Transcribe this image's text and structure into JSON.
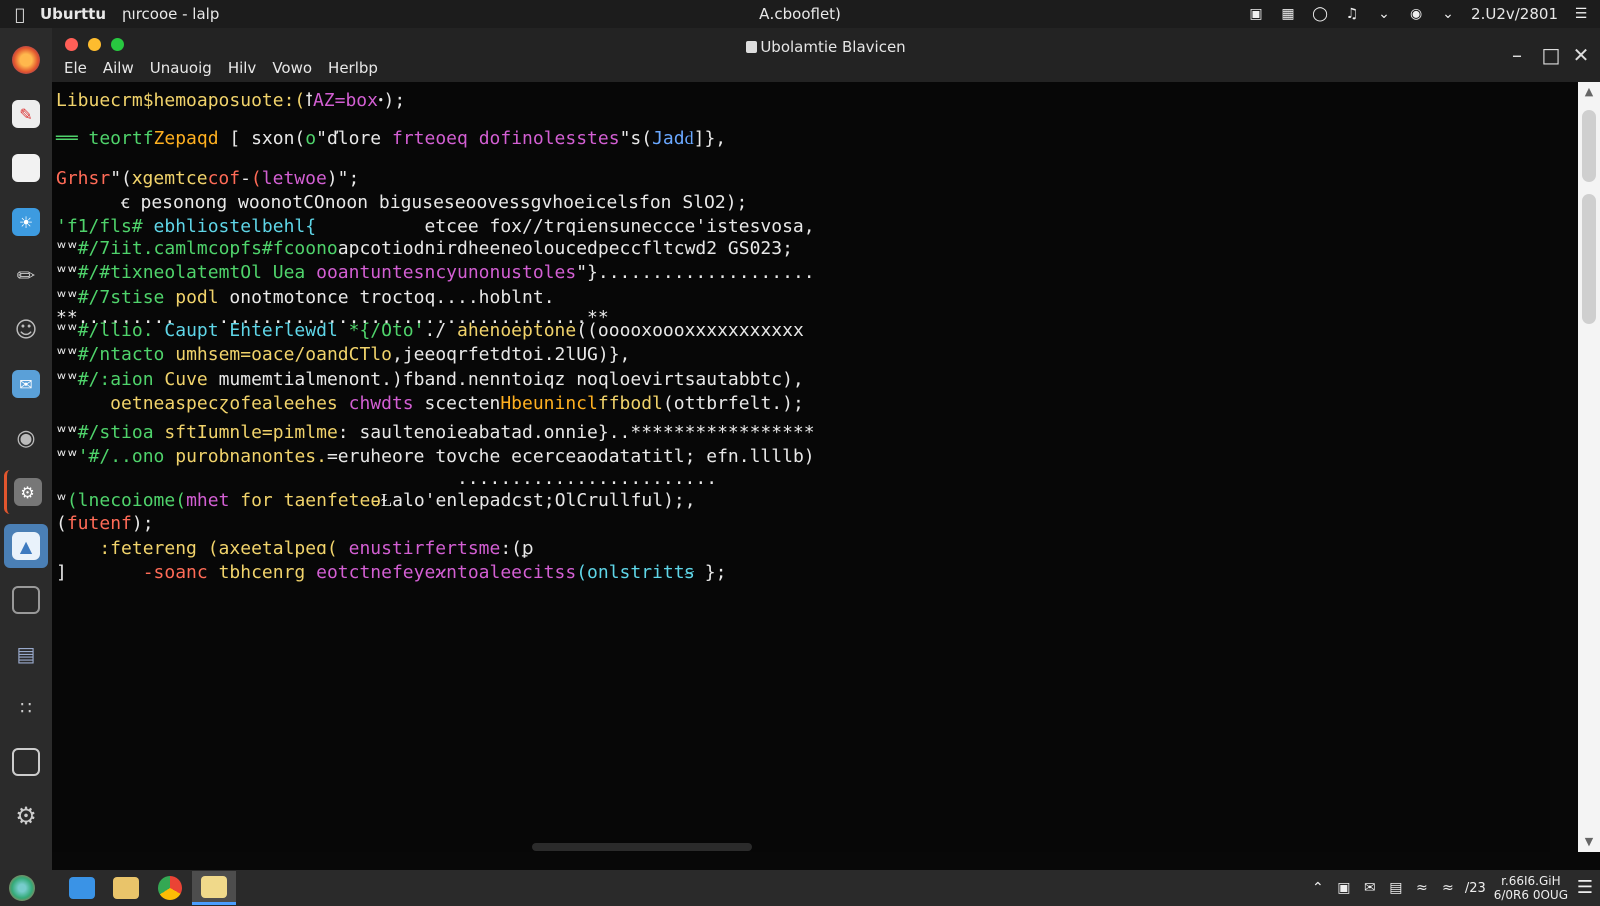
{
  "topbar": {
    "app_name": "Uburttu",
    "app_menu": "ꞃırcooe - lalp",
    "center_title": "A․cbooflet)",
    "clock": "2.U2v/2801"
  },
  "window": {
    "title": "Ubolamtie Blavicen",
    "menu": [
      "Ele",
      "Ailw",
      "Unauoig",
      "Hilv",
      "Vowo",
      "Herlbp"
    ]
  },
  "terminal_lines": [
    [
      {
        "t": "Libuecrm$hemoaposuote:(",
        "c": "c-y"
      },
      {
        "t": "ꝉ",
        "c": "c-w"
      },
      {
        "t": "AZ=box",
        "c": "c-p"
      },
      {
        "t": "ꞏ);",
        "c": "c-w"
      }
    ],
    [
      {
        "t": "══ teortf",
        "c": "c-g"
      },
      {
        "t": "Zepaqd",
        "c": "c-o"
      },
      {
        "t": " [ sxon(",
        "c": "c-w"
      },
      {
        "t": "o",
        "c": "c-g"
      },
      {
        "t": "\"ďlore ",
        "c": "c-w"
      },
      {
        "t": "frteoeq ",
        "c": "c-p"
      },
      {
        "t": "dofinolesstes",
        "c": "c-p"
      },
      {
        "t": "\"s(",
        "c": "c-w"
      },
      {
        "t": "Jadԁ",
        "c": "c-b"
      },
      {
        "t": "]},",
        "c": "c-w"
      }
    ],
    [
      {
        "t": "Grhsr",
        "c": "c-r"
      },
      {
        "t": "\"(",
        "c": "c-w"
      },
      {
        "t": "ⅹgemtce",
        "c": "c-y"
      },
      {
        "t": "cof",
        "c": "c-r"
      },
      {
        "t": "-",
        "c": "c-w"
      },
      {
        "t": "(",
        "c": "c-r"
      },
      {
        "t": "letwoe",
        "c": "c-p"
      },
      {
        "t": ")\";",
        "c": "c-w"
      }
    ],
    [
      {
        "t": "      ꞓ pesonong woonotCOnoon biguseseoovessgvhoeicelsfon SlO2);",
        "c": "c-w"
      }
    ],
    [
      {
        "t": "'f1/fls#",
        "c": "c-g"
      },
      {
        "t": " ebhliostelbehl{          ",
        "c": "c-c"
      },
      {
        "t": "etcee fox//trqiensuneccce'istesvosa,",
        "c": "c-w"
      }
    ],
    [
      {
        "t": "ʷʷ",
        "c": "c-w"
      },
      {
        "t": "#/7iit.camlmcopfs#fcoono",
        "c": "c-g"
      },
      {
        "t": "apcotiodnirdheeneoloucedpeccfltcwd2 GS023;",
        "c": "c-w"
      }
    ],
    [
      {
        "t": "ʷʷ",
        "c": "c-w"
      },
      {
        "t": "#/#tixneolatemtOl Uea ",
        "c": "c-g"
      },
      {
        "t": "ooantuntesncyunonustoles",
        "c": "c-p"
      },
      {
        "t": "\"}....................",
        "c": "c-w"
      }
    ],
    [
      {
        "t": "ʷʷ",
        "c": "c-w"
      },
      {
        "t": "#/7stise",
        "c": "c-g"
      },
      {
        "t": " podl ",
        "c": "c-y"
      },
      {
        "t": "onotmotonce troctoq....hoblnt.",
        "c": "c-w"
      }
    ],
    [
      {
        "t": "**.........    ..................................**",
        "c": "c-w"
      }
    ],
    [
      {
        "t": "ʷʷ",
        "c": "c-w"
      },
      {
        "t": "#/llio. ",
        "c": "c-g"
      },
      {
        "t": "Caupt Ehterlewdl ",
        "c": "c-c"
      },
      {
        "t": "*{/Oto'",
        "c": "c-g"
      },
      {
        "t": "./ ",
        "c": "c-w"
      },
      {
        "t": "ahenoeptone",
        "c": "c-y"
      },
      {
        "t": "((ooooxoooxxxxxxxxxxx",
        "c": "c-w"
      }
    ],
    [
      {
        "t": "ʷʷ",
        "c": "c-w"
      },
      {
        "t": "#/ntacto ",
        "c": "c-g"
      },
      {
        "t": "umhsem=oace/oandCTlo",
        "c": "c-y"
      },
      {
        "t": ",jeeoqrfetdtoi.2lUG)},",
        "c": "c-w"
      }
    ],
    [
      {
        "t": "ʷʷ",
        "c": "c-w"
      },
      {
        "t": "#/:aion ",
        "c": "c-g"
      },
      {
        "t": "Cuve ",
        "c": "c-y"
      },
      {
        "t": "mumemtialmenont.)fband.nenntoiqz noqloevirtsautabbtc),",
        "c": "c-w"
      }
    ],
    [
      {
        "t": "     oetneaspecɀofealeehes ",
        "c": "c-y"
      },
      {
        "t": "chwdts ",
        "c": "c-p"
      },
      {
        "t": "scecten",
        "c": "c-w"
      },
      {
        "t": "Hbeunincl",
        "c": "c-o"
      },
      {
        "t": "ffbodl",
        "c": "c-y"
      },
      {
        "t": "(ottbrfelt.);",
        "c": "c-w"
      }
    ],
    [
      {
        "t": "ʷʷ",
        "c": "c-w"
      },
      {
        "t": "#/stioa ",
        "c": "c-g"
      },
      {
        "t": "sftIumnle=pimlme",
        "c": "c-y"
      },
      {
        "t": ": saultenoieabatad.onnie}..*****************",
        "c": "c-w"
      }
    ],
    [
      {
        "t": "ʷʷ",
        "c": "c-w"
      },
      {
        "t": "'#/..ono ",
        "c": "c-g"
      },
      {
        "t": "purobnanontes.",
        "c": "c-y"
      },
      {
        "t": "=eruheore tovche ecerceaodatatitl; efn.llllb)",
        "c": "c-w"
      }
    ],
    [
      {
        "t": "                                     ........................",
        "c": "c-w"
      }
    ],
    [
      {
        "t": "ʷ",
        "c": "c-w"
      },
      {
        "t": "(lnecoiome(",
        "c": "c-g"
      },
      {
        "t": "mhet",
        "c": "c-p"
      },
      {
        "t": " for ",
        "c": "c-y"
      },
      {
        "t": "taenfeteѳ",
        "c": "c-y"
      },
      {
        "t": "Ɫalo'enlepadcst;OlCrullful);,",
        "c": "c-w"
      }
    ],
    [
      {
        "t": "(",
        "c": "c-w"
      },
      {
        "t": "futenf",
        "c": "c-r"
      },
      {
        "t": ");",
        "c": "c-w"
      }
    ],
    [
      {
        "t": "    :fetereng ",
        "c": "c-y"
      },
      {
        "t": "(axeetalpeɑ( ",
        "c": "c-y"
      },
      {
        "t": "enustirfertsme",
        "c": "c-p"
      },
      {
        "t": ":(ꝑ",
        "c": "c-w"
      }
    ],
    [
      {
        "t": "]  ",
        "c": "c-w"
      },
      {
        "t": "     -soanc ",
        "c": "c-r"
      },
      {
        "t": "tbhcenrg ",
        "c": "c-y"
      },
      {
        "t": "eotctnefeyeϰntoaleecitss",
        "c": "c-p"
      },
      {
        "t": "(onlstrittꞩ ",
        "c": "c-c"
      },
      {
        "t": "};",
        "c": "c-w"
      }
    ]
  ],
  "icons": {
    "dock": [
      "firefox-icon",
      "pdf-icon",
      "files-icon",
      "image-viewer-icon",
      "pen-icon",
      "user-icon",
      "mail-icon",
      "webcam-icon",
      "settings-icon",
      "photos-icon",
      "folder-icon",
      "stats-icon",
      "apps-grid-icon",
      "terminal-icon",
      "gear-icon",
      "ubuntu-icon"
    ],
    "taskbar": [
      "finder-icon",
      "folder-icon",
      "chrome-icon",
      "file-manager-icon"
    ]
  },
  "tray": {
    "time_line1": "r.66I6.GiH",
    "time_line2": "6/0R6 0OUG",
    "lang": "/23"
  }
}
